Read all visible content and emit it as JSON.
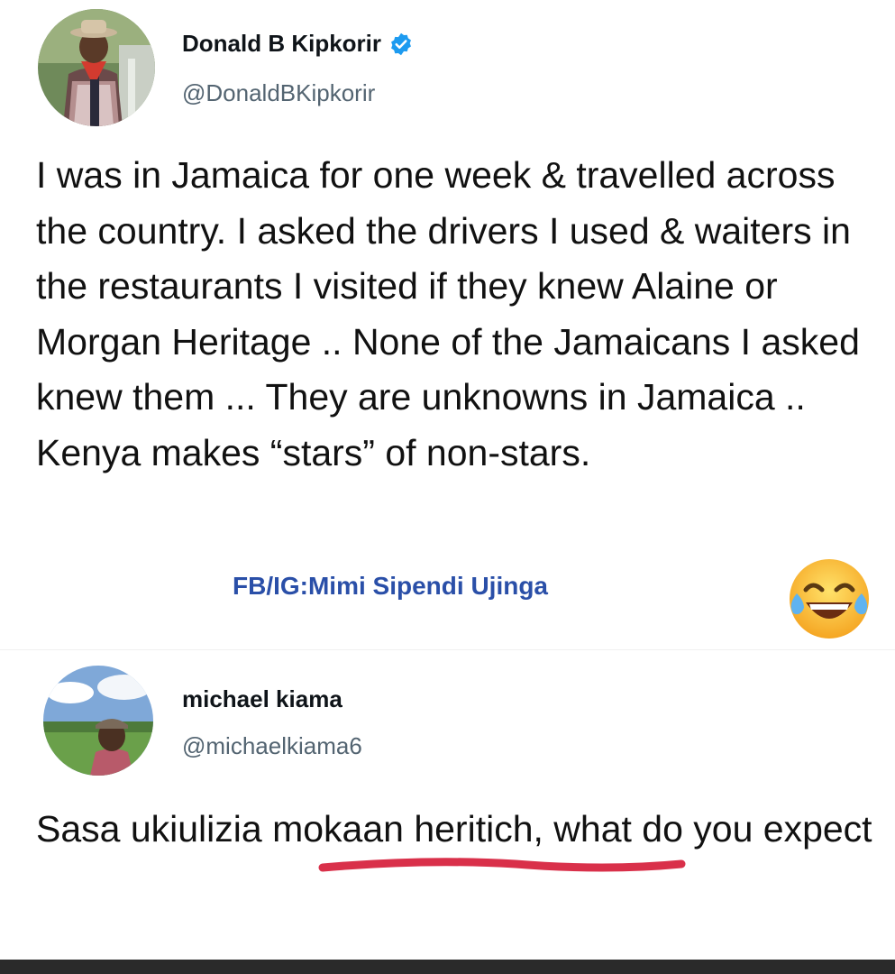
{
  "tweet": {
    "author_name": "Donald B Kipkorir",
    "author_handle": "@DonaldBKipkorir",
    "verified_icon": "verified-badge-icon",
    "text": "I was in Jamaica for one week & travelled across the country. I asked the drivers I used & waiters in the restaurants I visited if they knew Alaine or Morgan Heritage .. None of the Jamaicans I asked knew them ... They are unknowns in Jamaica .. Kenya makes “stars” of non-stars."
  },
  "watermark": {
    "text": "FB/IG:Mimi Sipendi Ujinga"
  },
  "emoji": {
    "icon": "face-with-tears-of-joy-emoji"
  },
  "reply": {
    "author_name": "michael kiama",
    "author_handle": "@michaelkiama6",
    "text": "Sasa ukiulizia mokaan heritich, what do you expect"
  },
  "colors": {
    "verified": "#1d9bf0",
    "watermark": "#2a4fa8",
    "underline": "#d9304a",
    "handle": "#536471"
  }
}
